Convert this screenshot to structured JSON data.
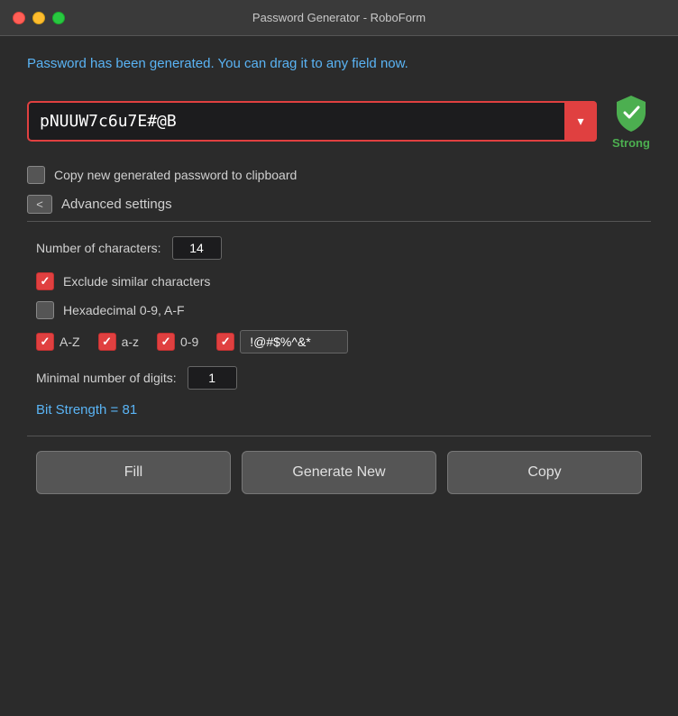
{
  "titleBar": {
    "title": "Password Generator - RoboForm"
  },
  "statusMessage": "Password has been generated. You can drag it to any field now.",
  "password": {
    "value": "pNUUW7c6u7E#@B",
    "dropdownArrow": "▾",
    "strengthLabel": "Strong"
  },
  "copyCheckbox": {
    "label": "Copy new generated password to clipboard",
    "checked": false
  },
  "advancedSettings": {
    "toggleLabel": "<",
    "label": "Advanced settings",
    "numCharsLabel": "Number of characters:",
    "numCharsValue": "14",
    "excludeSimilarLabel": "Exclude similar characters",
    "excludeSimilarChecked": true,
    "hexLabel": "Hexadecimal 0-9, A-F",
    "hexChecked": false,
    "azLabel": "A-Z",
    "azChecked": true,
    "azLowerLabel": "a-z",
    "azLowerChecked": true,
    "digitsLabel": "0-9",
    "digitsChecked": true,
    "specialChecked": true,
    "specialValue": "!@#$%^&*",
    "minDigitsLabel": "Minimal number of digits:",
    "minDigitsValue": "1",
    "bitStrength": "Bit Strength = 81"
  },
  "buttons": {
    "fill": "Fill",
    "generateNew": "Generate New",
    "copy": "Copy"
  }
}
